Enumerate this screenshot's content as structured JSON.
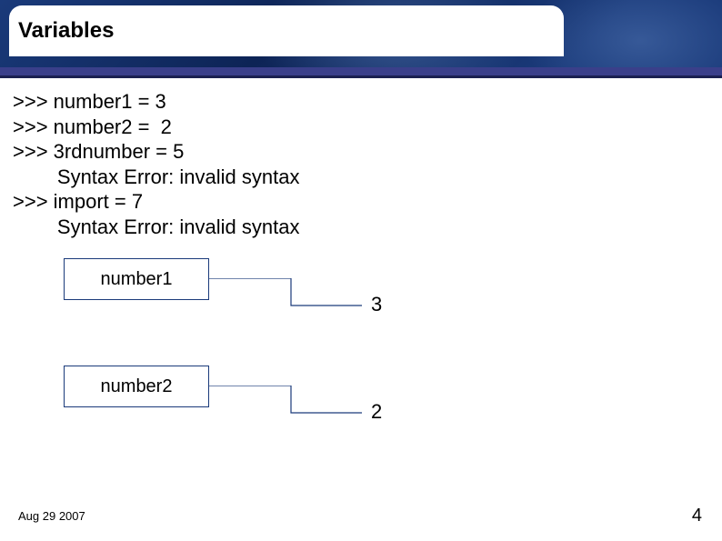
{
  "title": "Variables",
  "code_lines": [
    ">>> number1 = 3",
    ">>> number2 =  2",
    ">>> 3rdnumber = 5",
    "        Syntax Error: invalid syntax",
    ">>> import = 7",
    "        Syntax Error: invalid syntax"
  ],
  "diagram": {
    "box1_label": "number1",
    "box1_value": "3",
    "box2_label": "number2",
    "box2_value": "2"
  },
  "footer": {
    "date": "Aug 29 2007",
    "page": "4"
  }
}
